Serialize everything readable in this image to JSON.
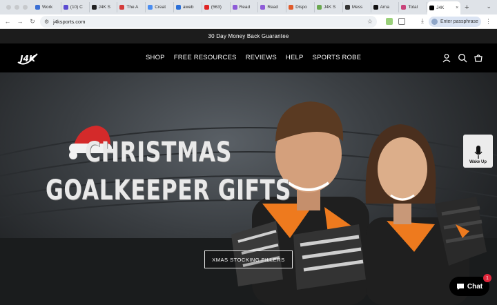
{
  "browser": {
    "tabs": [
      {
        "title": "Work",
        "color": "#3b6fd4"
      },
      {
        "title": "(10) C",
        "color": "#5b4bd1"
      },
      {
        "title": "J4K S",
        "color": "#222222"
      },
      {
        "title": "The A",
        "color": "#d43b3b"
      },
      {
        "title": "Creat",
        "color": "#4a8df0"
      },
      {
        "title": "aweb",
        "color": "#2a6fd8"
      },
      {
        "title": "(563)",
        "color": "#e02424"
      },
      {
        "title": "Read",
        "color": "#8e5bd8"
      },
      {
        "title": "Read",
        "color": "#8e5bd8"
      },
      {
        "title": "Dispo",
        "color": "#e05a2a"
      },
      {
        "title": "J4K S",
        "color": "#6aa84f"
      },
      {
        "title": "Mess",
        "color": "#333333"
      },
      {
        "title": "Ama",
        "color": "#111111"
      },
      {
        "title": "Total",
        "color": "#c9437a"
      }
    ],
    "active_tab": {
      "title": "J4K",
      "close": "×"
    },
    "new_tab": "+",
    "url": "j4ksports.com",
    "passphrase_label": "Enter passphrase"
  },
  "announcement": "30 Day Money Back Guarantee",
  "header": {
    "logo": "J4K",
    "nav": [
      "SHOP",
      "FREE RESOURCES",
      "REVIEWS",
      "HELP",
      "SPORTS ROBE"
    ]
  },
  "hero": {
    "line1": "CHRISTMAS",
    "line2": "GOALKEEPER GIFTS",
    "cta": "XMAS STOCKING FILLERS",
    "kit_color": "#ee7a1e"
  },
  "wake_up": {
    "label": "Wake Up"
  },
  "chat": {
    "label": "Chat",
    "badge": "1"
  },
  "icons": [
    "back-icon",
    "forward-icon",
    "reload-icon",
    "site-info-icon",
    "star-icon",
    "download-icon",
    "account-icon",
    "search-icon",
    "cart-icon",
    "microphone-icon",
    "chat-icon",
    "santa-hat-icon"
  ]
}
